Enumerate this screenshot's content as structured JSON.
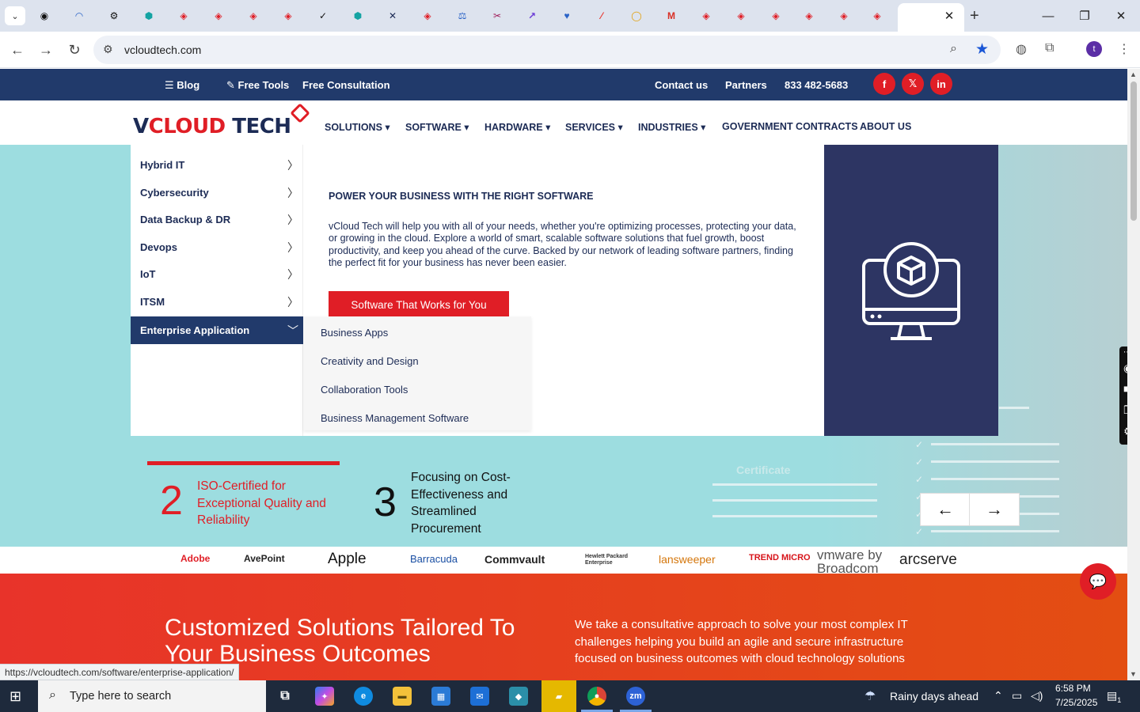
{
  "browser": {
    "tabs_menu_icon": "chevron-down-icon",
    "active_tab_close": "✕",
    "new_tab": "+",
    "url": "vcloudtech.com",
    "status_url": "https://vcloudtech.com/software/enterprise-application/",
    "profile_initial": "t"
  },
  "topbar": {
    "blog": "Blog",
    "free_tools": "Free Tools",
    "free_consultation": "Free Consultation",
    "contact": "Contact us",
    "partners": "Partners",
    "phone": "833 482-5683",
    "social": [
      "f",
      "𝕏",
      "in"
    ]
  },
  "logo": {
    "part1": "V",
    "part2": "CLOUD",
    "part3": " TECH"
  },
  "nav": {
    "items": [
      "SOLUTIONS ▾",
      "SOFTWARE ▾",
      "HARDWARE ▾",
      "SERVICES ▾",
      "INDUSTRIES ▾",
      "GOVERNMENT CONTRACTS",
      "ABOUT US"
    ]
  },
  "mega_menu": {
    "categories": [
      "Hybrid IT",
      "Cybersecurity",
      "Data Backup & DR",
      "Devops",
      "IoT",
      "ITSM",
      "Enterprise Application"
    ],
    "active_category": "Enterprise Application",
    "title": "POWER YOUR BUSINESS WITH THE RIGHT SOFTWARE",
    "description": "vCloud Tech will help you with all of your needs, whether you're optimizing processes, protecting your data, or growing in the cloud. Explore a world of smart, scalable software solutions that fuel growth, boost productivity, and keep you ahead of the curve. Backed by our network of leading software partners, finding the perfect fit for your business has never been easier.",
    "button": "Software That Works for You",
    "submenu": [
      "Business Apps",
      "Creativity and Design",
      "Collaboration Tools",
      "Business Management Software"
    ],
    "panel_icon": "computer-cube-icon"
  },
  "hero": {
    "certificate_text": "Certificate"
  },
  "stats": [
    {
      "num": "2",
      "text": "ISO-Certified for Exceptional Quality and Reliability"
    },
    {
      "num": "3",
      "text": "Focusing on Cost-Effectiveness and Streamlined Procurement"
    }
  ],
  "carousel": {
    "prev": "←",
    "next": "→"
  },
  "partner_logos": [
    "Adobe",
    "AvePoint",
    "Apple",
    "Barracuda",
    "Commvault",
    "Hewlett Packard Enterprise",
    "lansweeper",
    "TREND MICRO",
    "vmware by Broadcom",
    "arcserve"
  ],
  "bottom": {
    "heading": "Customized Solutions Tailored To Your Business Outcomes",
    "text": "We take a consultative approach to solve your most complex IT challenges helping you build an agile and secure infrastructure focused on business outcomes with cloud technology solutions"
  },
  "taskbar": {
    "search_placeholder": "Type here to search",
    "weather": "Rainy days ahead",
    "time": "6:58 PM",
    "date": "7/25/2025",
    "notifications": "1"
  },
  "colors": {
    "navy": "#213a6b",
    "red": "#e01e26",
    "hero": "#9ddde0",
    "panel": "#2d3563"
  }
}
